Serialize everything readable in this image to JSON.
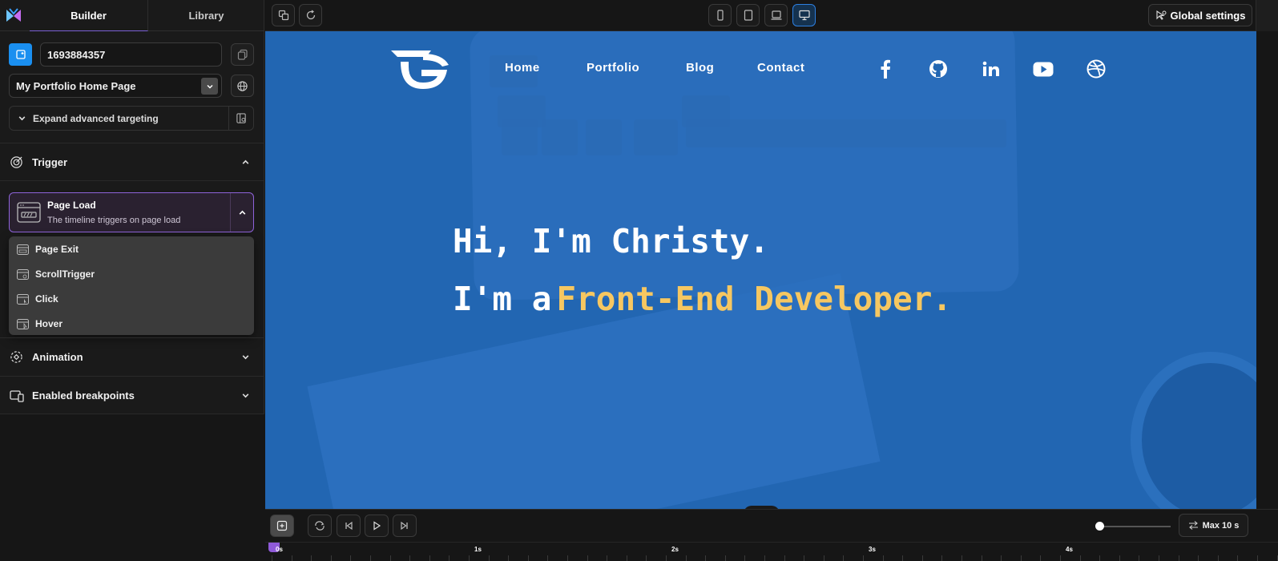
{
  "tabs": {
    "builder": "Builder",
    "library": "Library"
  },
  "page_id": "1693884357",
  "page_select": "My Portfolio Home Page",
  "expand_label": "Expand advanced targeting",
  "sections": {
    "trigger": "Trigger",
    "animation": "Animation",
    "breakpoints": "Enabled breakpoints"
  },
  "trigger": {
    "title": "Page Load",
    "desc": "The timeline triggers on page load"
  },
  "trigger_options": [
    "Page Exit",
    "ScrollTrigger",
    "Click",
    "Hover"
  ],
  "topbar": {
    "global_settings": "Global settings",
    "active_device": "desktop"
  },
  "site": {
    "nav": [
      "Home",
      "Portfolio",
      "Blog",
      "Contact"
    ],
    "social": [
      "facebook-icon",
      "github-icon",
      "linkedin-icon",
      "youtube-icon",
      "dribbble-icon"
    ],
    "hero_line1": "Hi, I'm Christy.",
    "hero_line2_prefix": "I'm a",
    "hero_line2_accent": "Front-End Developer.",
    "accent_color": "#f6c761",
    "background_color": "#2266b2"
  },
  "timeline": {
    "max_label": "Max 10 s",
    "ruler_labels": [
      "0s",
      "1s",
      "2s",
      "3s",
      "4s"
    ]
  },
  "colors": {
    "selection": "#8e63d9",
    "primary_blue": "#1a8ff0"
  }
}
